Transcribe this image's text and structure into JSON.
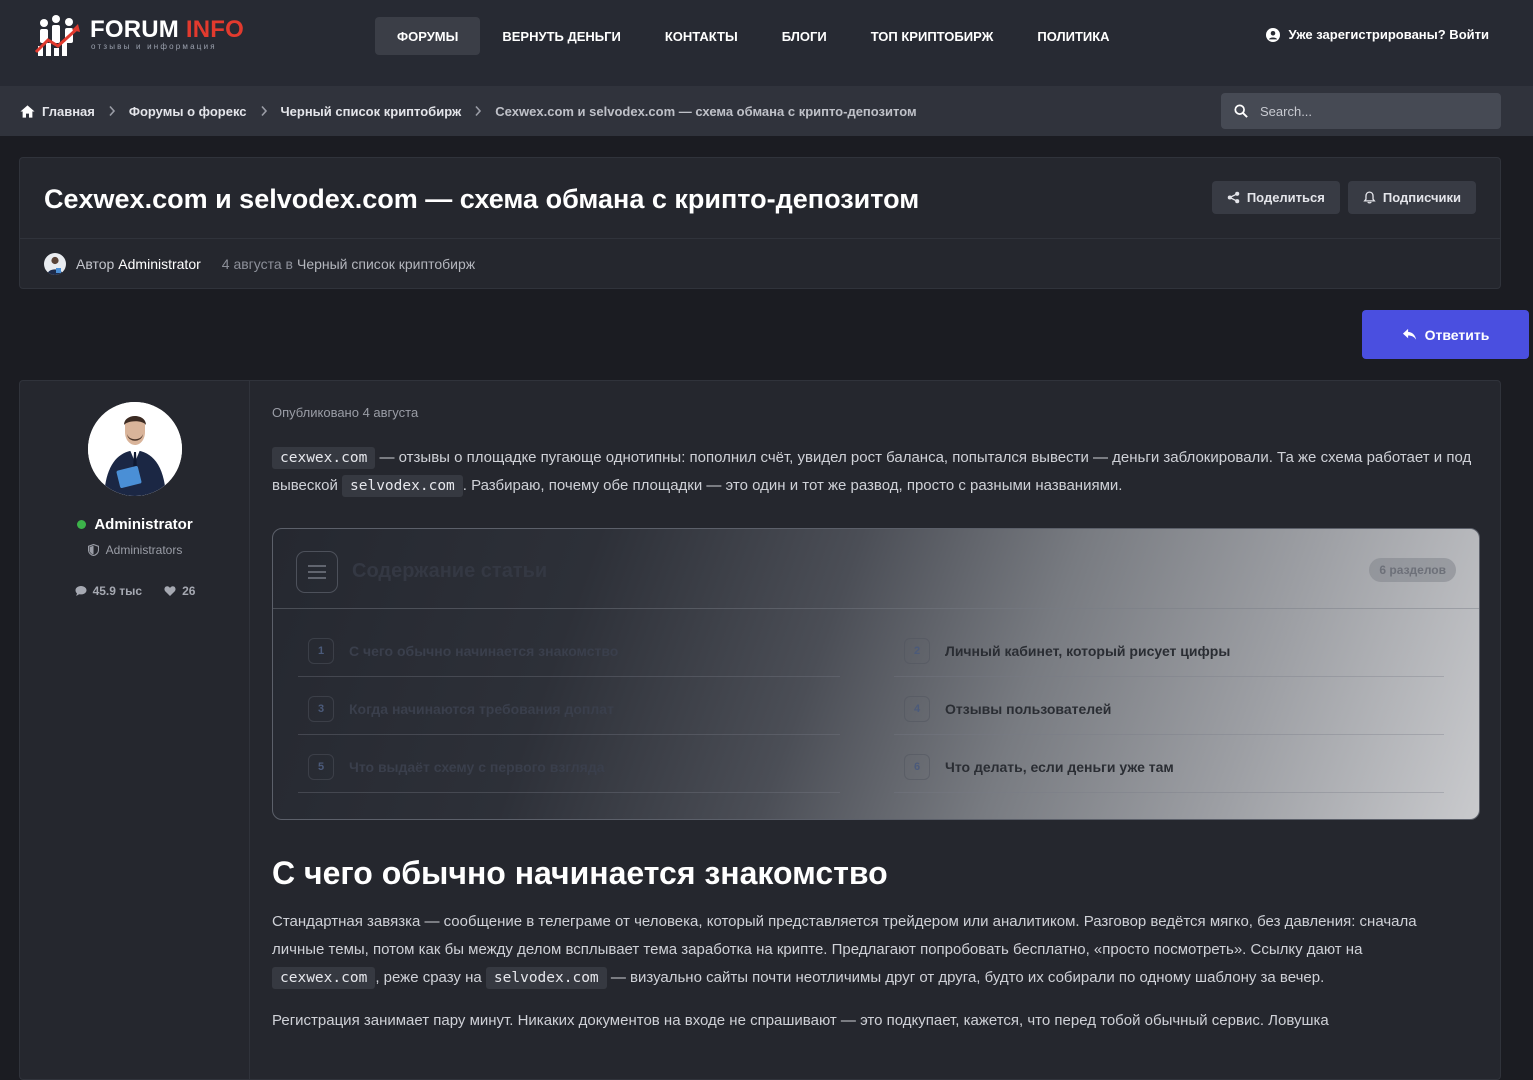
{
  "header": {
    "logo_main": "FORUM",
    "logo_accent": "INFO",
    "logo_sub": "отзывы и информация",
    "nav": [
      "ФОРУМЫ",
      "ВЕРНУТЬ ДЕНЬГИ",
      "КОНТАКТЫ",
      "БЛОГИ",
      "ТОП КРИПТОБИРЖ",
      "ПОЛИТИКА"
    ],
    "active_nav": "ФОРУМЫ",
    "login_label": "Уже зарегистрированы? Войти"
  },
  "breadcrumb": [
    "Главная",
    "Форумы о форекс",
    "Черный список криптобирж",
    "Cexwex.com и selvodex.com — схема обмана с крипто-депозитом"
  ],
  "search": {
    "placeholder": "Search..."
  },
  "topic": {
    "title": "Cexwex.com и selvodex.com — схема обмана с крипто-депозитом",
    "share_label": "Поделиться",
    "followers_label": "Подписчики",
    "author_label": "Автор",
    "author_name": "Administrator",
    "date_text": "4 августа в",
    "category": "Черный список криптобирж"
  },
  "reply_label": "Ответить",
  "sidebar": {
    "name": "Administrator",
    "group": "Administrators",
    "posts_count": "45.9 тыс",
    "reputation": "26"
  },
  "post": {
    "posted": "Опубликовано 4 августа",
    "intro": {
      "code1": "cexwex.com",
      "text1": " — отзывы о площадке пугающе однотипны: пополнил счёт, увидел рост баланса, попытался вывести — деньги заблокировали. Та же схема работает и под вывеской ",
      "code2": "selvodex.com",
      "text2": ". Разбираю, почему обе площадки — это один и тот же развод, просто с разными названиями."
    },
    "toc": {
      "title": "Содержание статьи",
      "badge": "6 разделов",
      "items": [
        {
          "num": "1",
          "label": "С чего обычно начинается знакомство"
        },
        {
          "num": "2",
          "label": "Личный кабинет, который рисует цифры"
        },
        {
          "num": "3",
          "label": "Когда начинаются требования доплат"
        },
        {
          "num": "4",
          "label": "Отзывы пользователей"
        },
        {
          "num": "5",
          "label": "Что выдаёт схему с первого взгляда"
        },
        {
          "num": "6",
          "label": "Что делать, если деньги уже там"
        }
      ]
    },
    "section1": {
      "heading": "С чего обычно начинается знакомство",
      "text1": "Стандартная завязка — сообщение в телеграме от человека, который представляется трейдером или аналитиком. Разговор ведётся мягко, без давления: сначала личные темы, потом как бы между делом всплывает тема заработка на крипте. Предлагают попробовать бесплатно, «просто посмотреть». Ссылку дают на ",
      "code1": "cexwex.com",
      "text2": ", реже сразу на ",
      "code2": "selvodex.com",
      "text3": " — визуально сайты почти неотличимы друг от друга, будто их собирали по одному шаблону за вечер.",
      "para2": "Регистрация занимает пару минут. Никаких документов на входе не спрашивают — это подкупает, кажется, что перед тобой обычный сервис. Ловушка"
    }
  },
  "colors": {
    "accent": "#4a4fe0",
    "logo_accent": "#e23a2e",
    "online": "#3cb34a"
  }
}
